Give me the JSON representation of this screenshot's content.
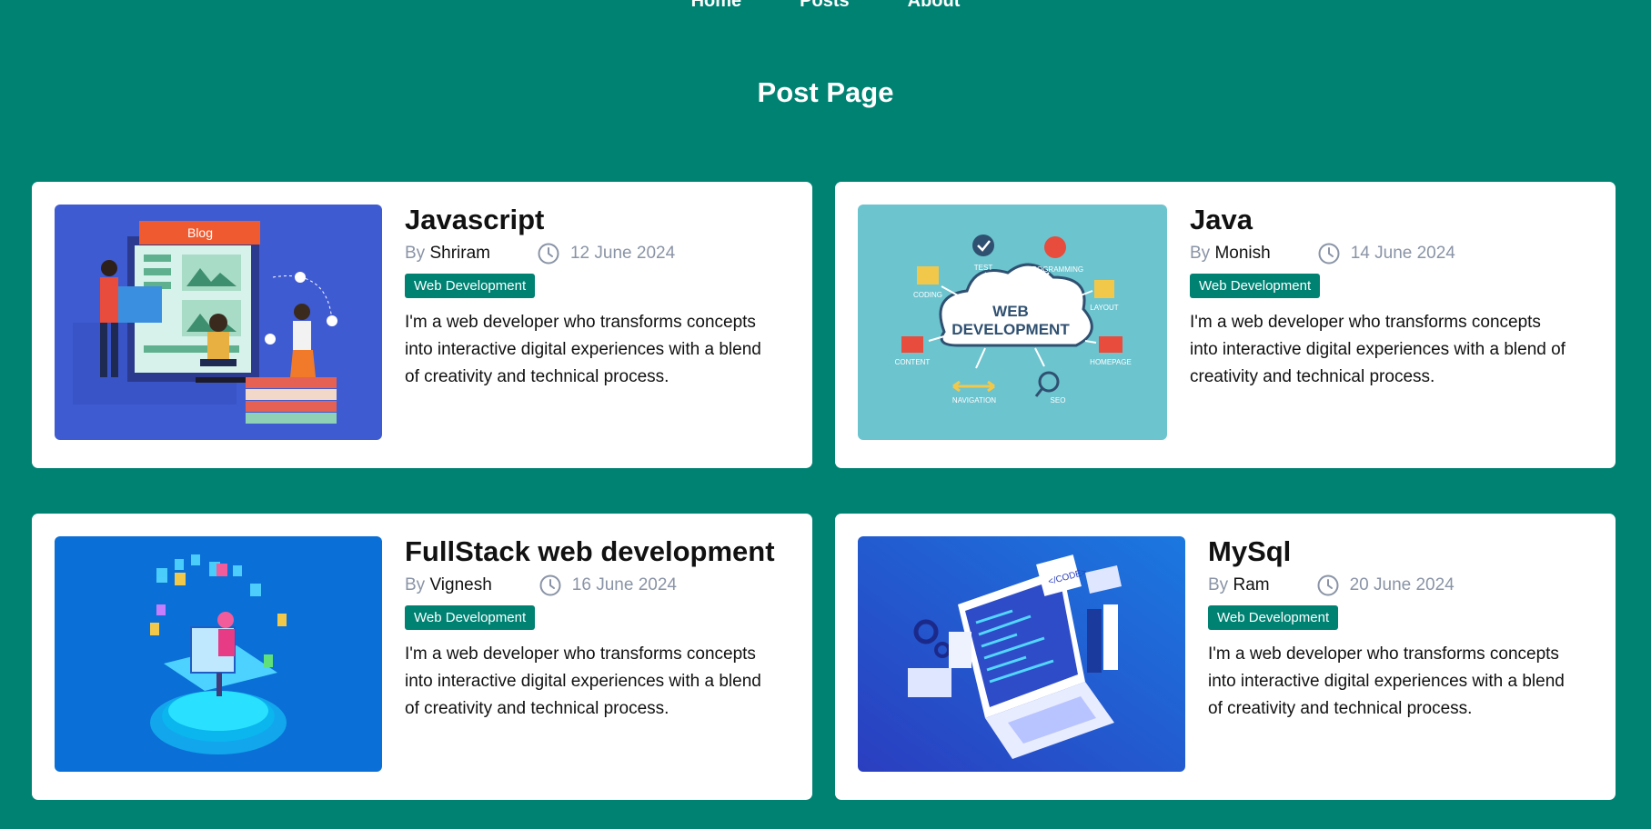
{
  "nav": {
    "items": [
      "Home",
      "Posts",
      "About"
    ]
  },
  "page": {
    "title": "Post Page"
  },
  "posts": [
    {
      "title": "Javascript",
      "by_label": "By",
      "author": "Shriram",
      "date": "12 June 2024",
      "category": "Web Development",
      "description": "I'm a web developer who transforms concepts into interactive digital experiences with a blend of creativity and technical process.",
      "image": {
        "text": "Blog"
      }
    },
    {
      "title": "Java",
      "by_label": "By",
      "author": "Monish",
      "date": "14 June 2024",
      "category": "Web Development",
      "description": "I'm a web developer who transforms concepts into interactive digital experiences with a blend of creativity and technical process.",
      "image": {
        "title_line1": "WEB",
        "title_line2": "DEVELOPMENT",
        "labels": [
          "TEST",
          "PROGRAMMING",
          "CODING",
          "LAYOUT",
          "CONTENT",
          "HOMEPAGE",
          "NAVIGATION",
          "SEO"
        ]
      }
    },
    {
      "title": "FullStack web development",
      "by_label": "By",
      "author": "Vignesh",
      "date": "16 June 2024",
      "category": "Web Development",
      "description": "I'm a web developer who transforms concepts into interactive digital experiences with a blend of creativity and technical process.",
      "image": {}
    },
    {
      "title": "MySql",
      "by_label": "By",
      "author": "Ram",
      "date": "20 June 2024",
      "category": "Web Development",
      "description": "I'm a web developer who transforms concepts into interactive digital experiences with a blend of creativity and technical process.",
      "image": {
        "text": "</CODE>"
      }
    }
  ],
  "colors": {
    "background": "#008273",
    "badge": "#008273",
    "card": "#ffffff",
    "meta_gray": "#8a94a6"
  },
  "icons": {
    "date": "clock-icon"
  }
}
